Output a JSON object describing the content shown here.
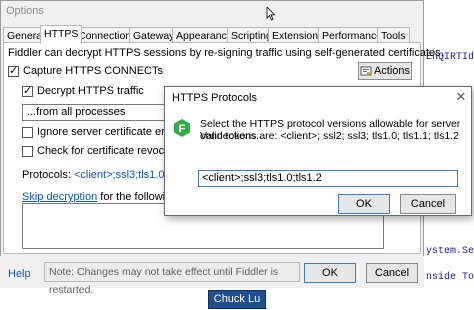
{
  "code_lines": [
    {
      "text": "EnQIRTIdi"
    },
    {
      "text": "ystem.Sec"
    },
    {
      "text": "nside Too"
    }
  ],
  "options": {
    "title": "Options",
    "tabs": [
      {
        "label": "General"
      },
      {
        "label": "HTTPS"
      },
      {
        "label": "Connections"
      },
      {
        "label": "Gateway"
      },
      {
        "label": "Appearance"
      },
      {
        "label": "Scripting"
      },
      {
        "label": "Extensions"
      },
      {
        "label": "Performance"
      },
      {
        "label": "Tools"
      }
    ],
    "active_tab": "HTTPS",
    "https": {
      "description": "Fiddler can decrypt HTTPS sessions by re-signing traffic using self-generated certificates.",
      "capture_label": "Capture HTTPS CONNECTs",
      "capture_checked": true,
      "actions_label": "Actions",
      "decrypt_label": "Decrypt HTTPS traffic",
      "decrypt_checked": true,
      "process_value": "...from all processes",
      "ignore_errors_label": "Ignore server certificate errors (",
      "ignore_errors_checked": false,
      "revocation_label": "Check for certificate revocation",
      "revocation_checked": false,
      "protocols_prefix": "Protocols:",
      "protocols_value": "<client>;ssl3;tls1.0",
      "skip_link": "Skip decryption",
      "skip_suffix": "for the following ho"
    },
    "footer": {
      "help_label": "Help",
      "note": "Note: Changes may not take effect until Fiddler is restarted.",
      "ok_label": "OK",
      "cancel_label": "Cancel"
    }
  },
  "taskbar_tip": "Chuck Lu",
  "dialog": {
    "title": "HTTPS Protocols",
    "icon": "fiddler-logo-icon",
    "message_line1": "Select the HTTPS protocol versions allowable for server connections.",
    "message_line2": "Valid tokens are: <client>; ssl2; ssl3; tls1.0; tls1.1; tls1.2",
    "input_value": "<client>;ssl3;tls1.0;tls1.2",
    "ok_label": "OK",
    "cancel_label": "Cancel",
    "close_glyph": "✕"
  },
  "colors": {
    "link": "#0a55c8",
    "fiddler_green": "#2fae4b",
    "focus_border": "#3a7bd5",
    "taskbar_blue": "#1f4e91"
  }
}
